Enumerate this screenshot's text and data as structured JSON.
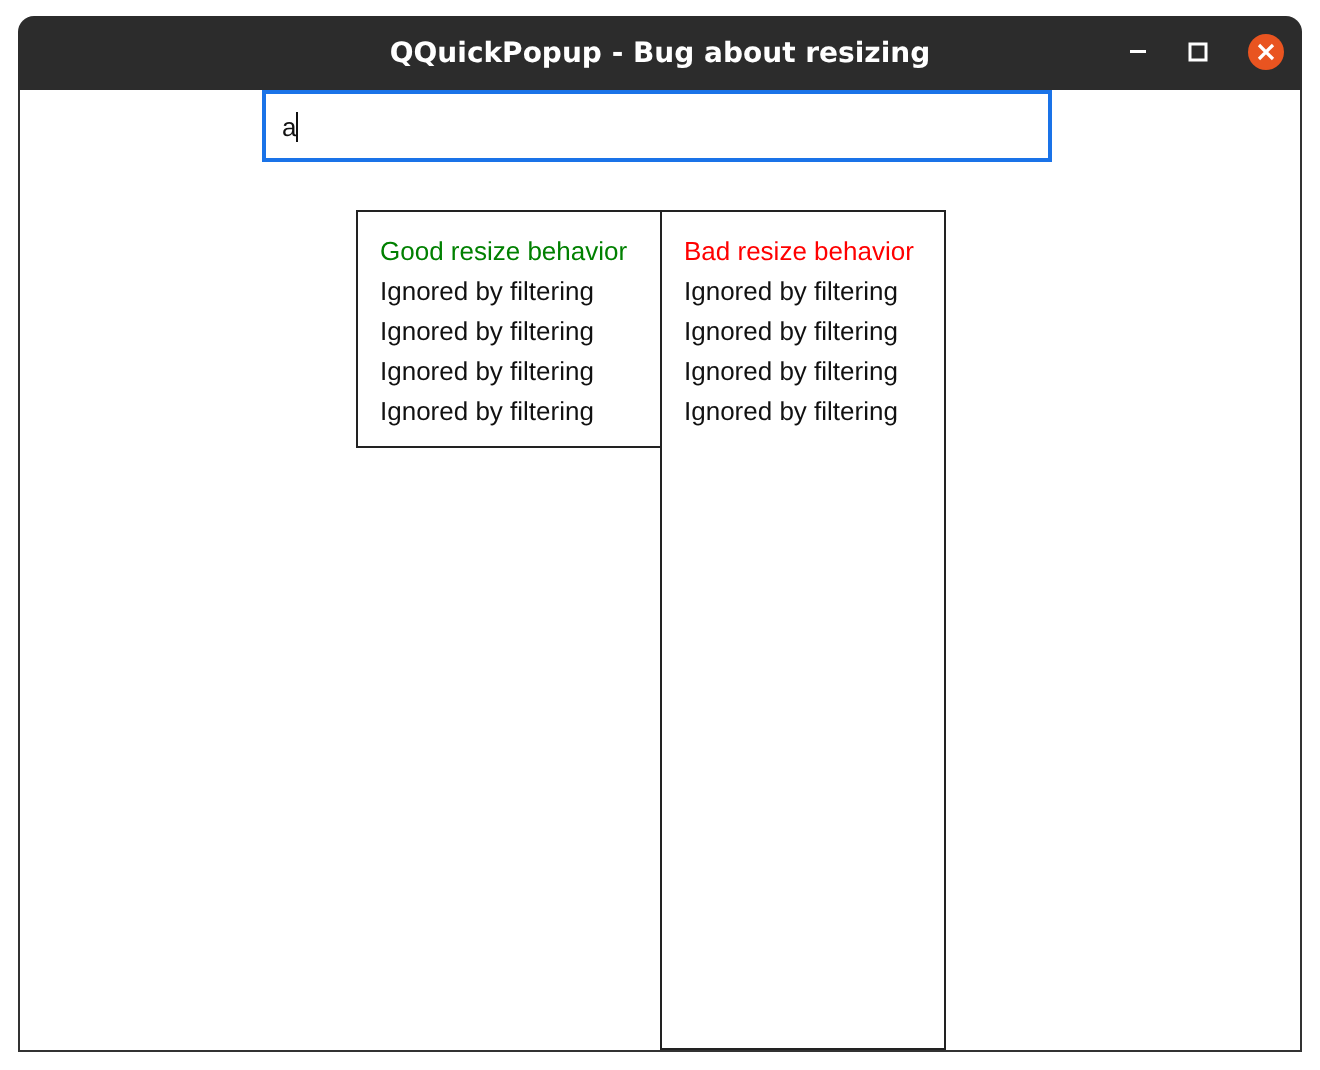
{
  "window": {
    "title": "QQuickPopup - Bug about resizing"
  },
  "search": {
    "value": "a"
  },
  "popups": [
    {
      "heading": {
        "text": "Good resize behavior",
        "color": "#008000"
      },
      "items": [
        "Ignored by filtering",
        "Ignored by filtering",
        "Ignored by filtering",
        "Ignored by filtering"
      ]
    },
    {
      "heading": {
        "text": "Bad resize behavior",
        "color": "#ff0000"
      },
      "items": [
        "Ignored by filtering",
        "Ignored by filtering",
        "Ignored by filtering",
        "Ignored by filtering"
      ]
    }
  ]
}
